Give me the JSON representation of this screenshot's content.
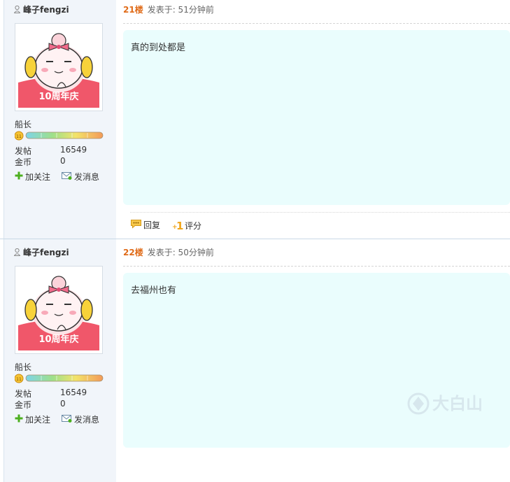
{
  "posts": [
    {
      "username": "峰子fengzi",
      "avatar_caption": "10周年庆",
      "rank": "船长",
      "level_badge": "11",
      "stats": [
        {
          "key": "发帖",
          "value": "16549"
        },
        {
          "key": "金币",
          "value": "0"
        }
      ],
      "follow_label": "加关注",
      "message_label": "发消息",
      "floor": "21楼",
      "posted": "发表于: 51分钟前",
      "content": "真的到处都是",
      "reply_label": "回复",
      "rate_label": "评分"
    },
    {
      "username": "峰子fengzi",
      "avatar_caption": "10周年庆",
      "rank": "船长",
      "level_badge": "11",
      "stats": [
        {
          "key": "发帖",
          "value": "16549"
        },
        {
          "key": "金币",
          "value": "0"
        }
      ],
      "follow_label": "加关注",
      "message_label": "发消息",
      "floor": "22楼",
      "posted": "发表于: 50分钟前",
      "content": "去福州也有",
      "reply_label": "回复",
      "rate_label": "评分"
    }
  ],
  "watermark": {
    "text": "大白山"
  },
  "colors": {
    "floor": "#e06c1a",
    "sidebar_bg": "#f1f5fa",
    "content_bg": "#eafdfd",
    "avatar_band": "#f0576a",
    "add_green": "#4caf1f"
  }
}
